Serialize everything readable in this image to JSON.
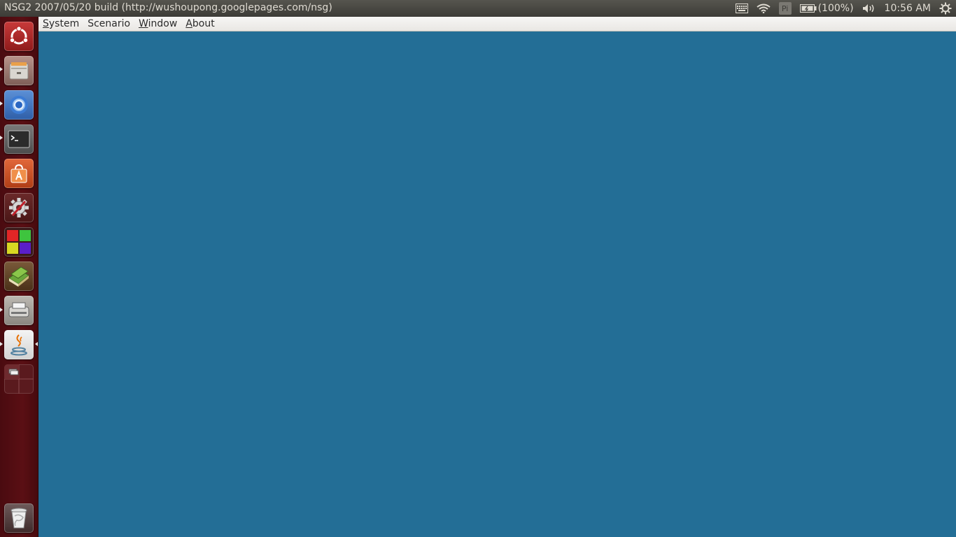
{
  "window": {
    "title": "NSG2 2007/05/20 build (http://wushoupong.googlepages.com/nsg)"
  },
  "indicators": {
    "keyboard_icon": "keyboard-icon",
    "wifi_icon": "wifi-icon",
    "pi_label": "Pi",
    "battery_icon": "battery-icon",
    "battery_text": "(100%)",
    "volume_icon": "volume-icon",
    "clock": "10:56 AM",
    "session_icon": "gear-icon"
  },
  "menubar": {
    "items": [
      {
        "mnemonic": "S",
        "rest": "ystem"
      },
      {
        "mnemonic": "",
        "rest": "Scenario"
      },
      {
        "mnemonic": "W",
        "rest": "indow"
      },
      {
        "mnemonic": "A",
        "rest": "bout"
      }
    ]
  },
  "launcher": {
    "items": [
      {
        "name": "dash-home",
        "icon": "ubuntu-logo-icon"
      },
      {
        "name": "files",
        "icon": "file-cabinet-icon"
      },
      {
        "name": "chromium",
        "icon": "chromium-icon"
      },
      {
        "name": "terminal",
        "icon": "terminal-icon"
      },
      {
        "name": "software-center",
        "icon": "shopping-bag-icon"
      },
      {
        "name": "system-settings",
        "icon": "settings-icon"
      },
      {
        "name": "workspace-app",
        "icon": "colored-squares-icon"
      },
      {
        "name": "reader",
        "icon": "books-icon"
      },
      {
        "name": "scanner",
        "icon": "scanner-icon"
      },
      {
        "name": "java",
        "icon": "java-icon"
      },
      {
        "name": "workspace-switcher",
        "icon": "workspace-switcher-icon"
      },
      {
        "name": "trash",
        "icon": "trash-icon"
      }
    ]
  },
  "colors": {
    "canvas": "#236e96",
    "launcher": "#5a0f14",
    "panel": "#3c3b37"
  }
}
